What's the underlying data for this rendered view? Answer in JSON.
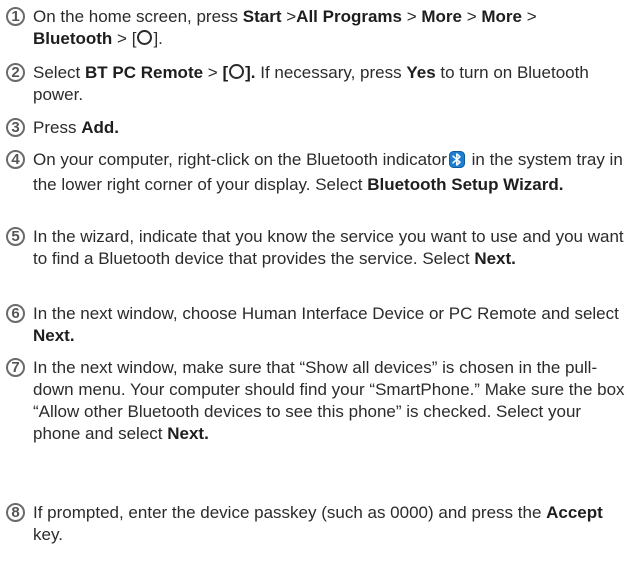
{
  "steps": [
    {
      "number": "1",
      "parts": [
        "On the home screen, press ",
        "Start",
        " >",
        "All Programs",
        " > ",
        "More",
        " > ",
        "More",
        " > ",
        "Bluetooth",
        " > [",
        "]."
      ]
    },
    {
      "number": "2",
      "parts": [
        "Select ",
        "BT PC Remote",
        " > ",
        "[",
        "].",
        " If necessary, press ",
        "Yes",
        " to turn on Bluetooth power."
      ]
    },
    {
      "number": "3",
      "parts": [
        "Press ",
        "Add."
      ]
    },
    {
      "number": "4",
      "parts": [
        "On your computer, right-click on the Bluetooth indicator",
        " in the system tray in the lower right corner of your display. Select ",
        "Bluetooth Setup Wizard."
      ],
      "icon": "bluetooth-icon"
    },
    {
      "number": "5",
      "parts": [
        "In the wizard, indicate that you know the service you want to use and you want to find a Bluetooth device that provides the service. Select ",
        "Next."
      ]
    },
    {
      "number": "6",
      "parts": [
        "In the next window, choose Human Interface Device or PC Remote and select ",
        "Next."
      ]
    },
    {
      "number": "7",
      "parts": [
        "In the next window, make sure that “Show all devices” is chosen in the pull-down menu. Your computer should find your “SmartPhone.” Make sure the box “Allow other Bluetooth devices to see this phone” is checked. Select your phone and select ",
        "Next."
      ]
    },
    {
      "number": "8",
      "parts": [
        "If prompted, enter the device passkey (such as 0000) and press the ",
        "Accept",
        " key."
      ]
    }
  ],
  "colors": {
    "text": "#2b2b2b",
    "number_ring": "#6b6b6b",
    "bluetooth_icon": "#1c7fd0"
  },
  "icons": {
    "circle_key": "circle-key-icon",
    "bluetooth": "bluetooth-icon"
  }
}
